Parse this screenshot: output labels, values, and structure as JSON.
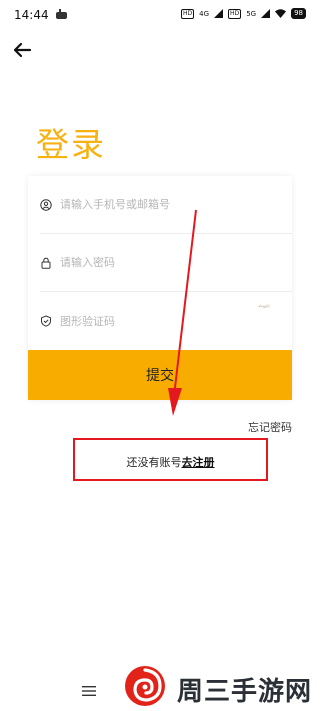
{
  "status_bar": {
    "time": "14:44",
    "indicators": [
      "HD",
      "4G",
      "HD",
      "5G"
    ],
    "battery": "98"
  },
  "header": {
    "back_icon": "arrow-left-icon"
  },
  "page": {
    "title": "登录"
  },
  "form": {
    "account_placeholder": "请输入手机号或邮箱号",
    "password_placeholder": "请输入密码",
    "captcha_placeholder": "图形验证码",
    "submit_label": "提交"
  },
  "links": {
    "forgot_password": "忘记密码",
    "no_account": "还没有账号",
    "register": "去注册"
  },
  "watermark": {
    "text": "周三手游网"
  },
  "colors": {
    "accent": "#f8ac00",
    "title": "#f7b212",
    "highlight_box": "#e3191f",
    "arrow": "#e3191f"
  }
}
